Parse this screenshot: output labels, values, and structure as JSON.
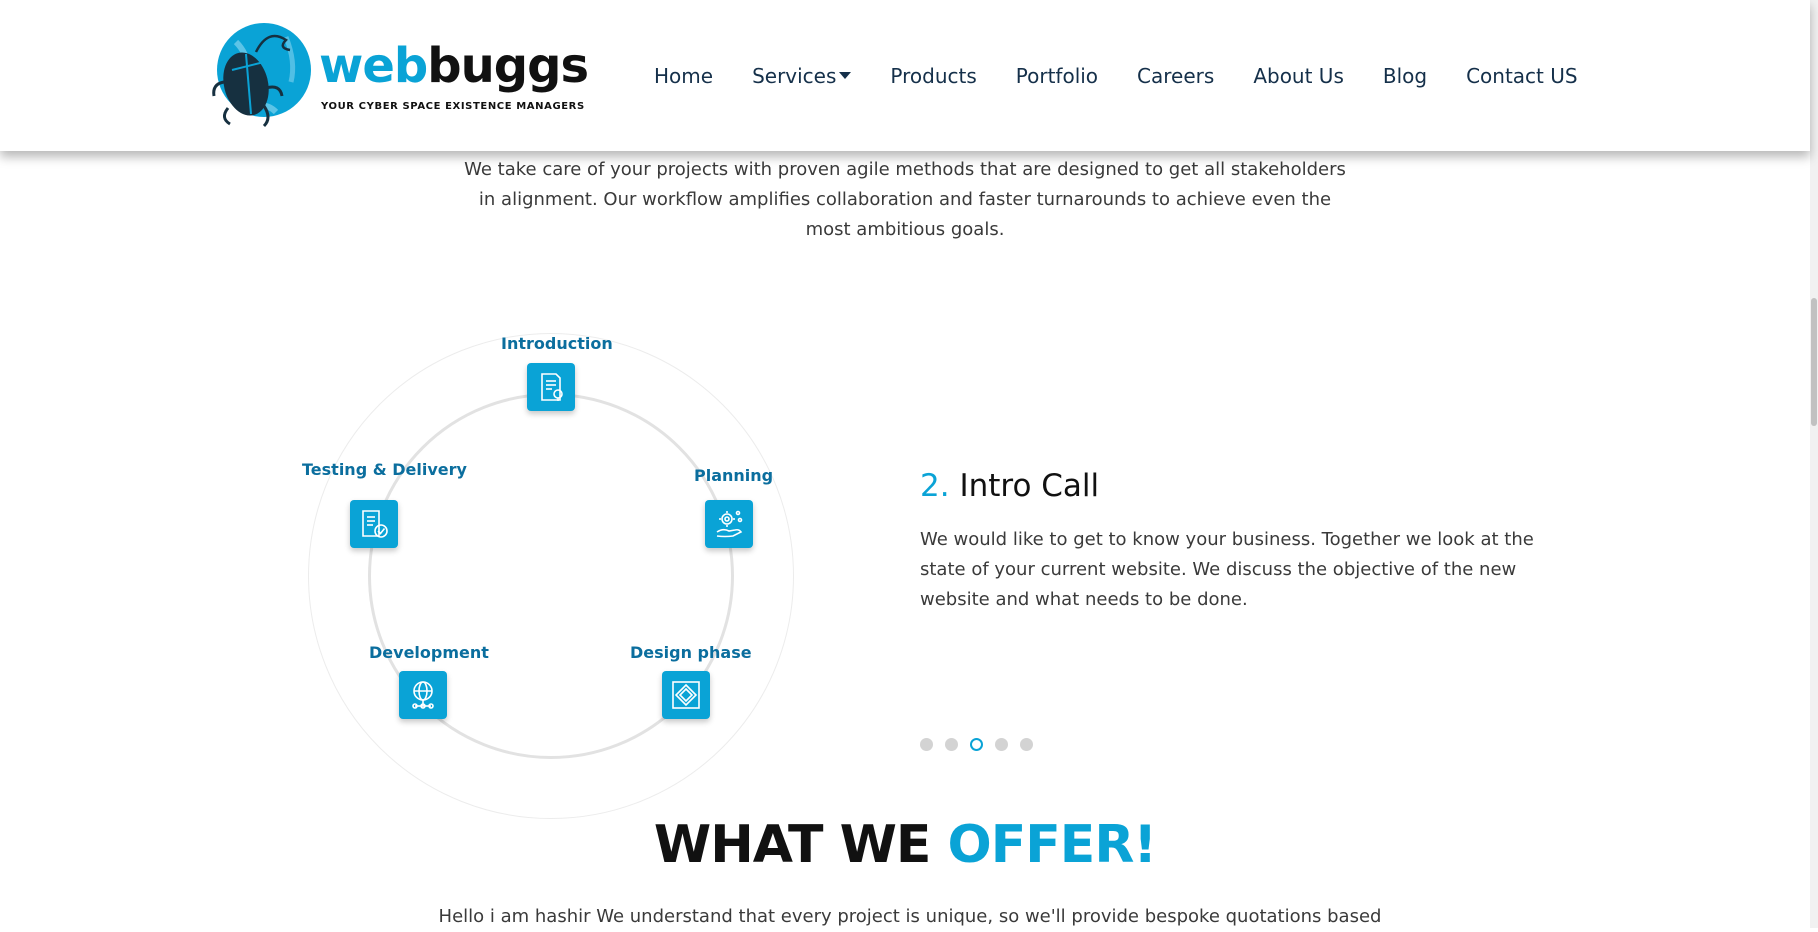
{
  "brand": {
    "name_part1": "web",
    "name_part2": "buggs",
    "tagline": "YOUR CYBER SPACE EXISTENCE MANAGERS",
    "colors": {
      "accent": "#0aa3d6",
      "dark": "#111111",
      "label_blue": "#0b6e9e"
    }
  },
  "nav": {
    "items": [
      {
        "label": "Home"
      },
      {
        "label": "Services",
        "icon": "caret-down-icon"
      },
      {
        "label": "Products"
      },
      {
        "label": "Portfolio"
      },
      {
        "label": "Careers"
      },
      {
        "label": "About Us"
      },
      {
        "label": "Blog"
      },
      {
        "label": "Contact US"
      }
    ]
  },
  "process": {
    "intro": "We take care of your projects with proven agile methods that are designed to get all stakeholders in alignment. Our workflow amplifies collaboration and faster turnarounds to achieve even the most ambitious goals.",
    "stages": [
      {
        "label": "Introduction",
        "icon": "document-bulb-icon"
      },
      {
        "label": "Planning",
        "icon": "gear-hand-icon"
      },
      {
        "label": "Design phase",
        "icon": "layers-diamond-icon"
      },
      {
        "label": "Development",
        "icon": "globe-network-icon"
      },
      {
        "label": "Testing & Delivery",
        "icon": "checklist-icon"
      }
    ],
    "current_step": {
      "number": "2.",
      "title": "Intro Call",
      "body": "We would like to get to know your business. Together we look at the state of your current website. We discuss the objective of the new website and what needs to be done."
    },
    "pager": {
      "count": 5,
      "active_index": 2
    }
  },
  "offer": {
    "title_part1": "WHAT WE ",
    "title_part2": "OFFER!",
    "text": "Hello i am hashir We understand that every project is unique, so we'll provide bespoke quotations based"
  }
}
